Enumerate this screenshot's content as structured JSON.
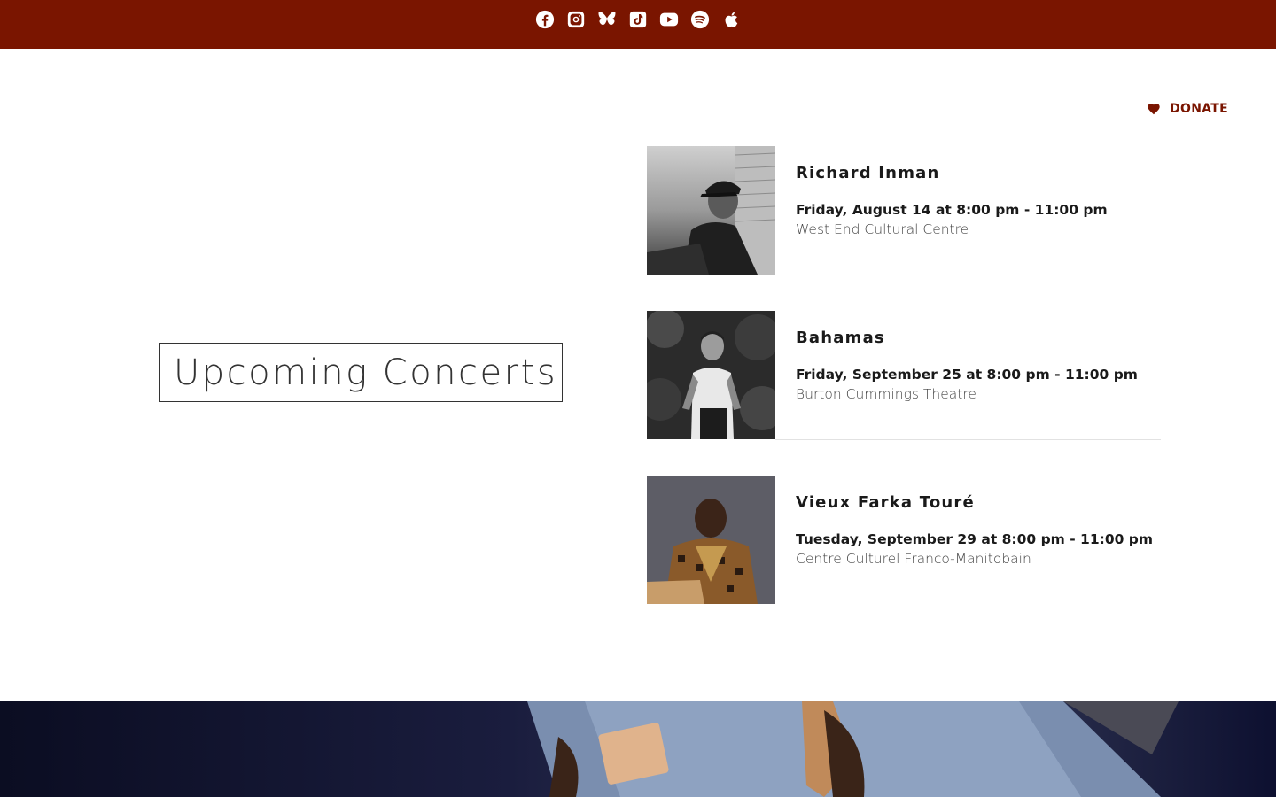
{
  "social_links": [
    {
      "icon": "facebook-icon"
    },
    {
      "icon": "instagram-icon"
    },
    {
      "icon": "bluesky-icon"
    },
    {
      "icon": "tiktok-icon"
    },
    {
      "icon": "youtube-icon"
    },
    {
      "icon": "spotify-icon"
    },
    {
      "icon": "apple-icon"
    }
  ],
  "donate": {
    "label": "DONATE",
    "icon": "heart-icon"
  },
  "section": {
    "title": "Upcoming Concerts"
  },
  "events": [
    {
      "name": "Richard Inman",
      "datetime": "Friday, August 14 at 8:00 pm - 11:00 pm",
      "venue": "West End Cultural Centre"
    },
    {
      "name": "Bahamas",
      "datetime": "Friday, September 25 at 8:00 pm - 11:00 pm",
      "venue": "Burton Cummings Theatre"
    },
    {
      "name": "Vieux Farka Touré",
      "datetime": "Tuesday, September 29 at 8:00 pm - 11:00 pm",
      "venue": "Centre Culturel Franco-Manitobain"
    }
  ],
  "colors": {
    "brand": "#7a1500",
    "text": "#1a1a1a",
    "muted": "#444444"
  }
}
